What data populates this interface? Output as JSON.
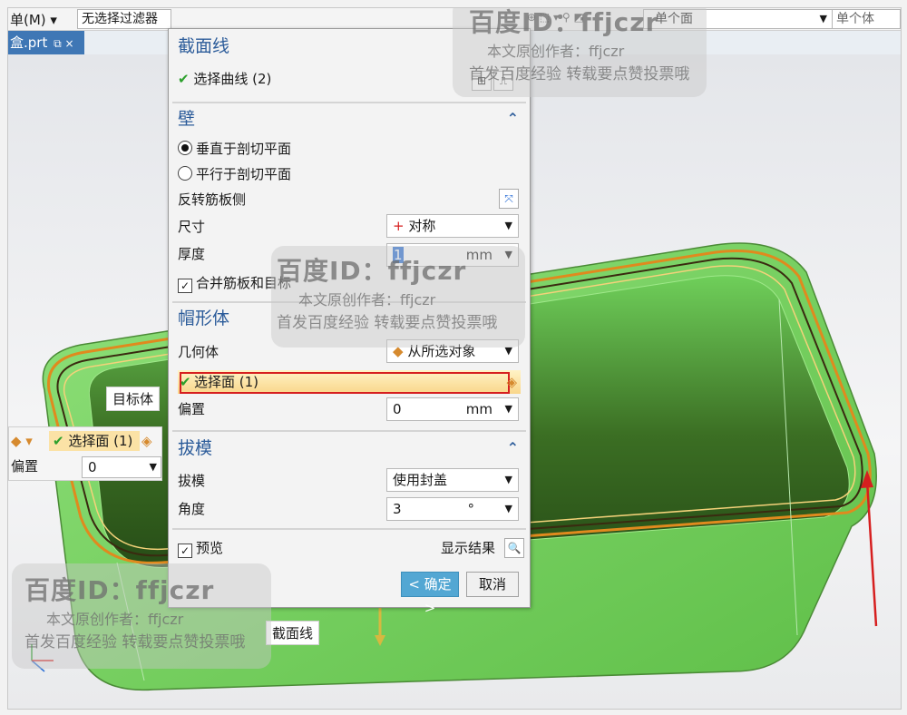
{
  "toolbar": {
    "menu_label": "菜单(M)",
    "menu_prefix": "菜",
    "menu_text": "单(M) ▾",
    "filter_text": "无选择过滤器",
    "select_scope": "单个面",
    "select_body": "单个体"
  },
  "tab": {
    "label": "盒.prt",
    "icons": "⧉ ×"
  },
  "dialog": {
    "section_curve": {
      "title": "截面线",
      "select_curve": "选择曲线 (2)"
    },
    "section_wall": {
      "title": "壁",
      "radio_perpendicular": "垂直于剖切平面",
      "radio_parallel": "平行于剖切平面",
      "flip_rib": "反转筋板侧",
      "size_label": "尺寸",
      "size_value": "对称",
      "thickness_label": "厚度",
      "thickness_value": "1",
      "thickness_unit": "mm",
      "merge_label": "合并筋板和目标",
      "merge_checked": true
    },
    "section_cap": {
      "title": "帽形体",
      "geometry_label": "几何体",
      "geometry_value": "从所选对象",
      "select_face": "选择面 (1)",
      "offset_label": "偏置",
      "offset_value": "0",
      "offset_unit": "mm"
    },
    "section_draft": {
      "title": "拔模",
      "draft_label": "拔模",
      "draft_value": "使用封盖",
      "angle_label": "角度",
      "angle_value": "3",
      "angle_unit": "°"
    },
    "preview_label": "预览",
    "preview_checked": true,
    "show_result": "显示结果",
    "ok_label": "< 确定 >",
    "cancel_label": "取消"
  },
  "viewport": {
    "target_body_label": "目标体",
    "section_line_label": "截面线",
    "mini_select_face": "选择面 (1)",
    "mini_offset_label": "偏置",
    "mini_offset_value": "0"
  },
  "watermarks": {
    "id_text": "百度ID：ffjczr",
    "author_text": "本文原创作者：ffjczr",
    "notice_text": "首发百度经验  转载要点赞投票哦"
  },
  "colors": {
    "model_green": "#7fd86a",
    "model_dark": "#2f5a1c",
    "edge_orange": "#e08a1e",
    "section_title": "#2c5c9a",
    "ok_button": "#53a7d3",
    "highlight_border": "#d61f1f",
    "arrow_red": "#d61f1f"
  }
}
